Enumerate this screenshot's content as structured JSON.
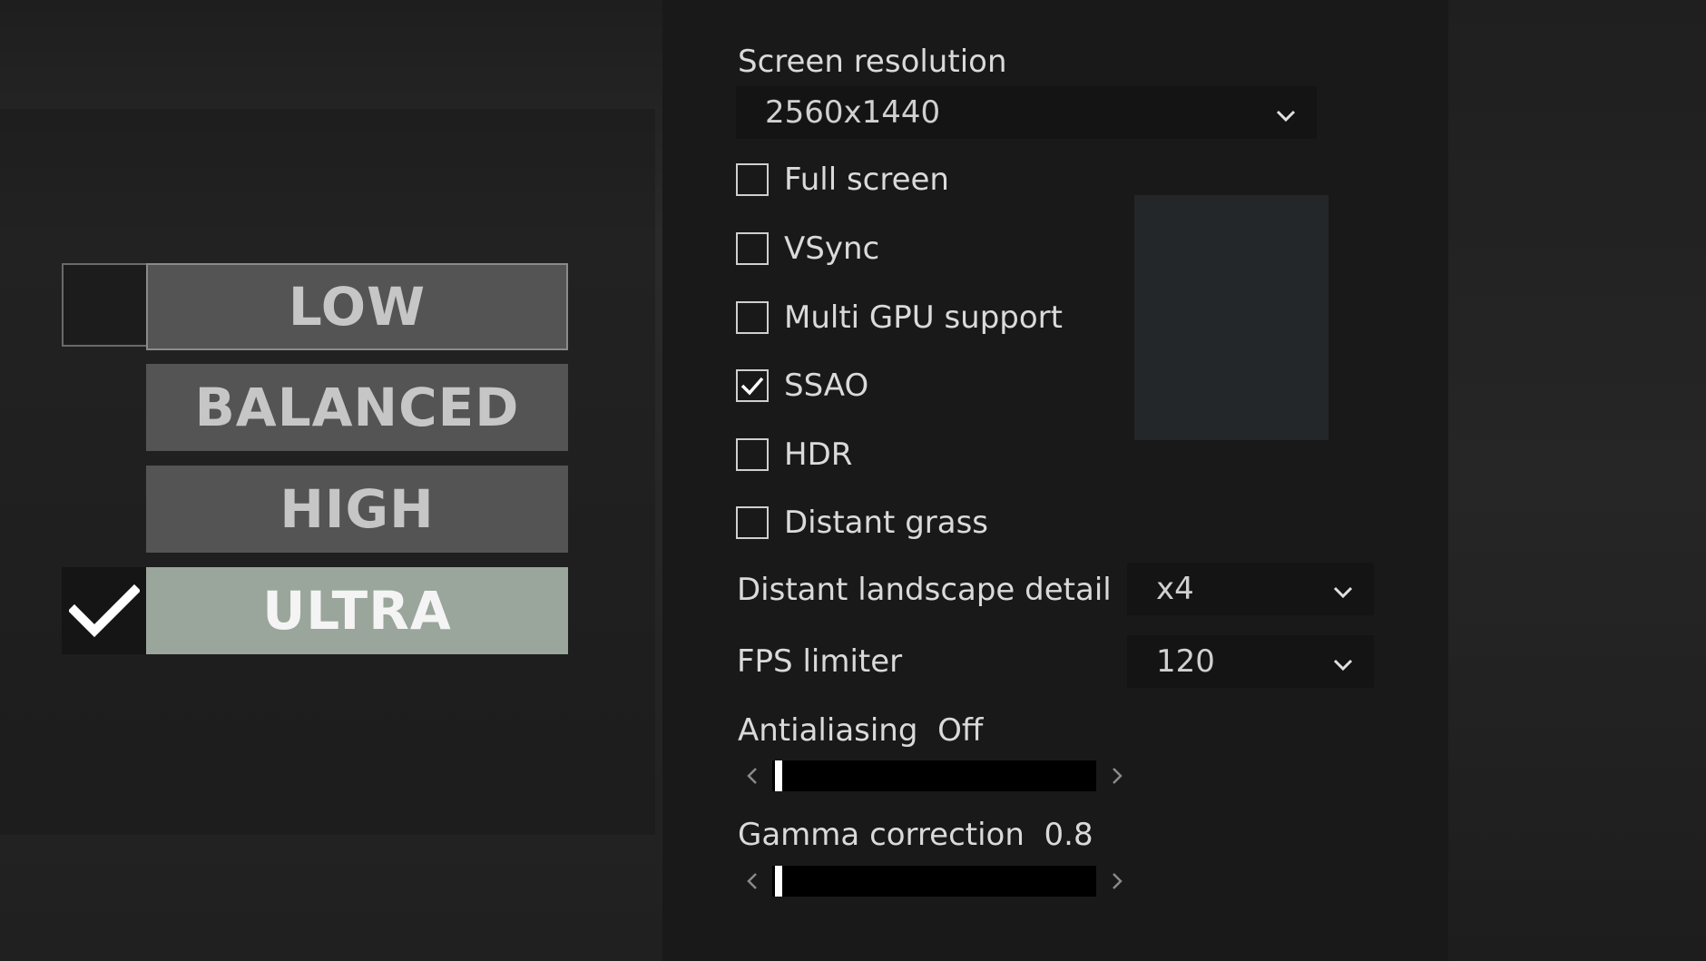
{
  "presets": [
    {
      "label": "LOW"
    },
    {
      "label": "BALANCED"
    },
    {
      "label": "HIGH"
    },
    {
      "label": "ULTRA"
    }
  ],
  "selected_preset": "ULTRA",
  "screen_resolution": {
    "label": "Screen resolution",
    "value": "2560x1440"
  },
  "checkboxes": [
    {
      "label": "Full screen",
      "checked": false
    },
    {
      "label": "VSync",
      "checked": false
    },
    {
      "label": "Multi GPU support",
      "checked": false
    },
    {
      "label": "SSAO",
      "checked": true
    },
    {
      "label": "HDR",
      "checked": false
    },
    {
      "label": "Distant grass",
      "checked": false
    }
  ],
  "distant_landscape": {
    "label": "Distant landscape detail",
    "value": "x4"
  },
  "fps_limiter": {
    "label": "FPS limiter",
    "value": "120"
  },
  "antialiasing": {
    "label": "Antialiasing",
    "value": "Off",
    "level": 0
  },
  "gamma": {
    "label": "Gamma correction",
    "value": "0.8",
    "level": 0
  },
  "colors": {
    "active_preset": "#9aa59b",
    "preset": "#545454",
    "track": "#000000"
  }
}
